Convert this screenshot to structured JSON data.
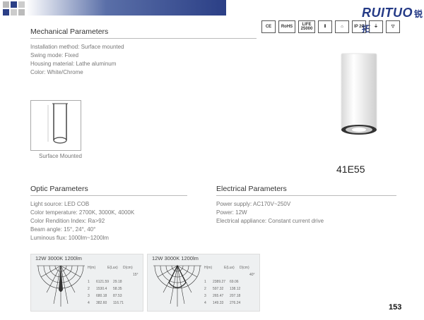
{
  "brand": {
    "name": "RUITUO",
    "cn": "锐拓"
  },
  "certs": [
    "CE",
    "RoHS",
    "LIFE 25000",
    "Ⅱ",
    "⌂",
    "IP 20",
    "⏚",
    "▽"
  ],
  "mechanical": {
    "title": "Mechanical Parameters",
    "lines": [
      "Installation method: Surface mounted",
      "Swing mode: Fixed",
      "Housing material: Lathe aluminum",
      "Color: White/Chrome"
    ],
    "thumb_caption": "Surface Mounted"
  },
  "model": "41E55",
  "optic": {
    "title": "Optic Parameters",
    "lines": [
      "Light source: LED COB",
      "Color temperature: 2700K,  3000K,  4000K",
      "Color Rendition Index: Ra>92",
      "Beam angle: 15°, 24°, 40°",
      "Luminous flux: 1000lm~1200lm"
    ]
  },
  "electrical": {
    "title": "Electrical Parameters",
    "lines": [
      "Power supply: AC170V~250V",
      "Power: 12W",
      "Electrical appliance: Constant current drive"
    ]
  },
  "panels": [
    {
      "title": "12W  3000K  1200lm",
      "headers": [
        "H(m)",
        "E(Lux)",
        "D(cm)"
      ],
      "angle": "15°",
      "rows": [
        [
          "1",
          "6121.59",
          "29.18"
        ],
        [
          "2",
          "1530.4",
          "58.35"
        ],
        [
          "3",
          "680.18",
          "87.53"
        ],
        [
          "4",
          "382.60",
          "116.71"
        ]
      ]
    },
    {
      "title": "12W  3000K  1200lm",
      "headers": [
        "H(m)",
        "E(Lux)",
        "D(cm)"
      ],
      "angle": "40°",
      "rows": [
        [
          "1",
          "2389.27",
          "69.06"
        ],
        [
          "2",
          "597.32",
          "138.12"
        ],
        [
          "3",
          "265.47",
          "207.18"
        ],
        [
          "4",
          "149.33",
          "276.24"
        ]
      ]
    }
  ],
  "page_number": "153"
}
